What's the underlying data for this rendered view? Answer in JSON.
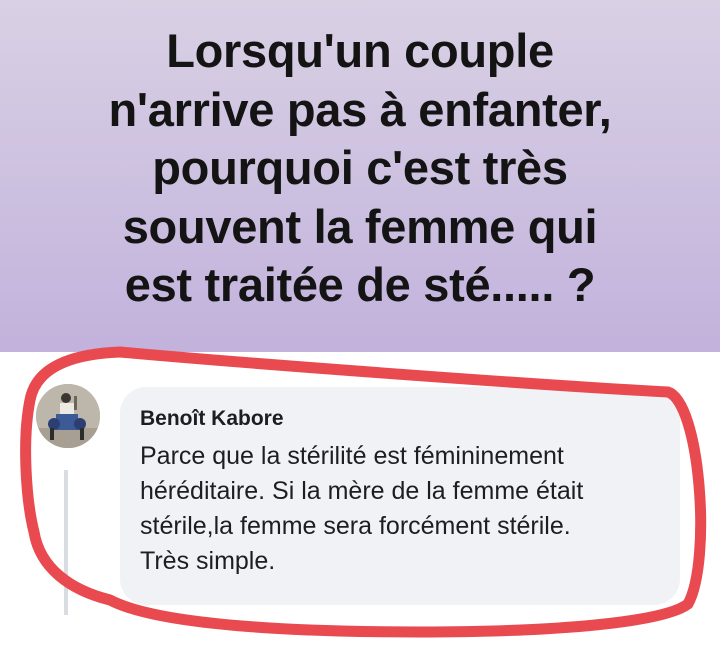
{
  "post": {
    "question_lines": [
      "Lorsqu'un couple",
      "n'arrive pas à enfanter,",
      "pourquoi c'est très",
      "souvent la femme qui",
      "est traitée de sté..... ?"
    ]
  },
  "comment": {
    "author": "Benoît Kabore",
    "lines": [
      "Parce que la stérilité est fémininement",
      "héréditaire. Si la mère de la femme était",
      "stérile,la femme sera forcément stérile.",
      "Très simple."
    ]
  },
  "colors": {
    "banner": "#c9bde0",
    "bubble": "#f0f2f5",
    "highlight": "#e84a4f"
  }
}
